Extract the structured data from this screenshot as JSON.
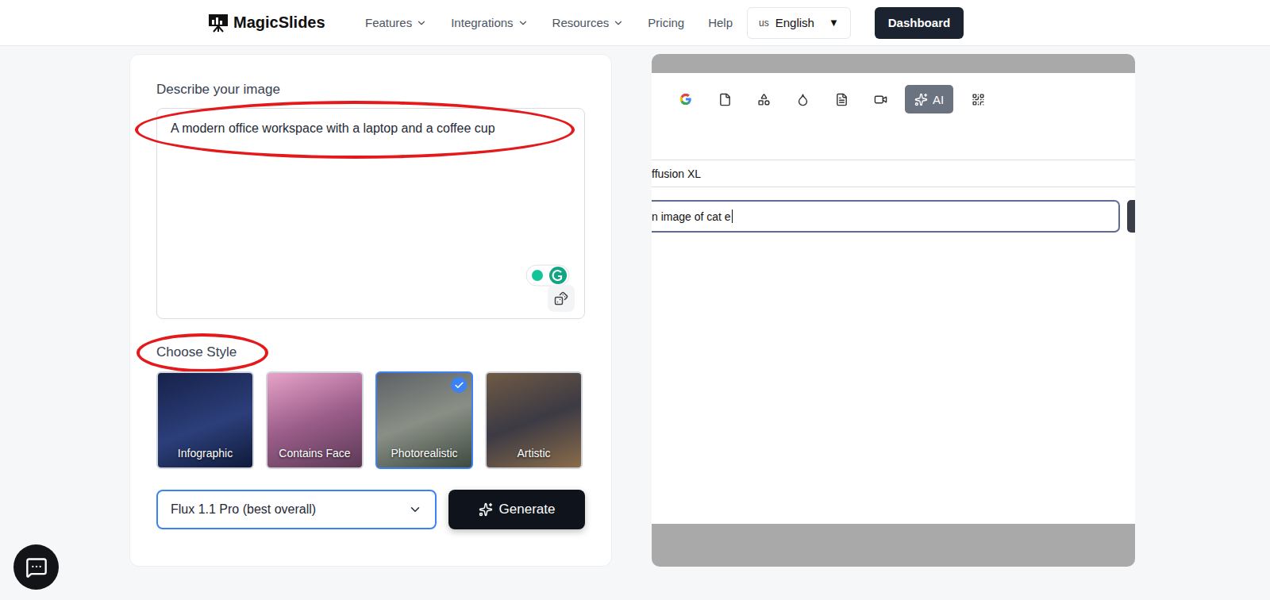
{
  "nav": {
    "logo": "MagicSlides",
    "items": [
      {
        "label": "Features",
        "dropdown": true
      },
      {
        "label": "Integrations",
        "dropdown": true
      },
      {
        "label": "Resources",
        "dropdown": true
      },
      {
        "label": "Pricing",
        "dropdown": false
      },
      {
        "label": "Help",
        "dropdown": false
      }
    ],
    "language": {
      "flag": "us",
      "label": "English",
      "arrow": "▼"
    },
    "dashboard": "Dashboard"
  },
  "form": {
    "prompt_label": "Describe your image",
    "prompt": "A modern office workspace with a laptop and a coffee cup",
    "style_label": "Choose Style",
    "styles": [
      {
        "label": "Infographic",
        "selected": false
      },
      {
        "label": "Contains Face",
        "selected": false
      },
      {
        "label": "Photorealistic",
        "selected": true
      },
      {
        "label": "Artistic",
        "selected": false
      }
    ],
    "model": "Flux 1.1 Pro (best overall)",
    "generate": "Generate"
  },
  "annotations": {
    "prompt": true,
    "style_label": true,
    "color": "#e3191c"
  },
  "preview": {
    "toolbar": [
      {
        "kind": "google",
        "selected": false
      },
      {
        "kind": "file",
        "selected": false
      },
      {
        "kind": "shapes",
        "selected": false
      },
      {
        "kind": "drop",
        "selected": false
      },
      {
        "kind": "pdf",
        "selected": false
      },
      {
        "kind": "video",
        "selected": false
      },
      {
        "kind": "ai",
        "label": "AI",
        "selected": true
      },
      {
        "kind": "qr",
        "selected": false
      }
    ],
    "model_text": "ffusion XL",
    "input": "n image of cat e"
  }
}
